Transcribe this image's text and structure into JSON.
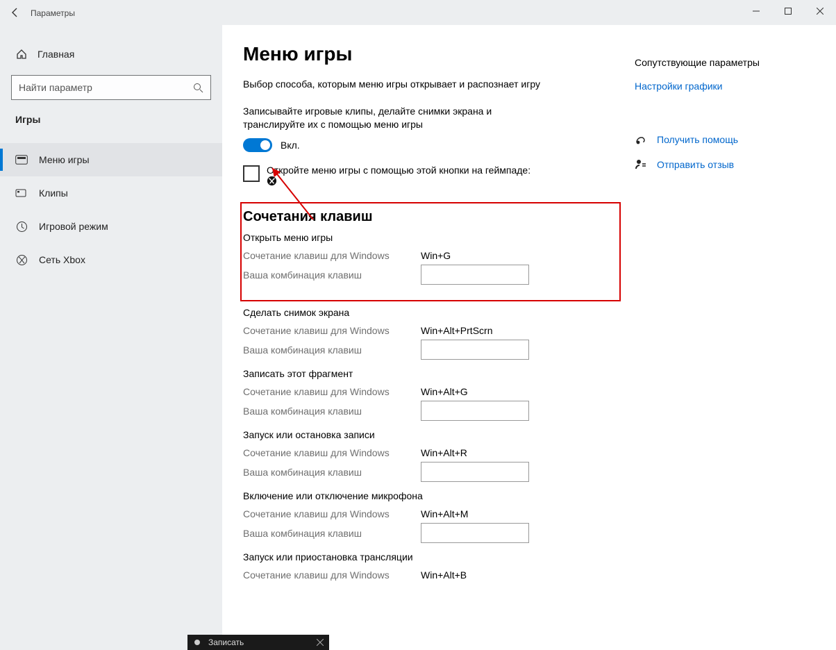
{
  "window": {
    "title": "Параметры"
  },
  "sidebar": {
    "home": "Главная",
    "search_placeholder": "Найти параметр",
    "category": "Игры",
    "items": [
      {
        "label": "Меню игры"
      },
      {
        "label": "Клипы"
      },
      {
        "label": "Игровой режим"
      },
      {
        "label": "Сеть Xbox"
      }
    ]
  },
  "page": {
    "heading": "Меню игры",
    "intro": "Выбор способа, которым меню игры открывает и распознает игру",
    "record_desc": "Записывайте игровые клипы, делайте снимки экрана и транслируйте их с помощью меню игры",
    "toggle_label": "Вкл.",
    "gamepad_checkbox": "Откройте меню игры с помощью этой кнопки на геймпаде:",
    "shortcuts_heading": "Сочетания клавиш",
    "labels": {
      "win_combo": "Сочетание клавиш для Windows",
      "custom_combo": "Ваша комбинация клавиш"
    },
    "shortcuts": [
      {
        "title": "Открыть меню игры",
        "win": "Win+G",
        "highlight": true
      },
      {
        "title": "Сделать снимок экрана",
        "win": "Win+Alt+PrtScrn"
      },
      {
        "title": "Записать этот фрагмент",
        "win": "Win+Alt+G"
      },
      {
        "title": "Запуск или остановка записи",
        "win": "Win+Alt+R"
      },
      {
        "title": "Включение или отключение микрофона",
        "win": "Win+Alt+M"
      },
      {
        "title": "Запуск или приостановка трансляции",
        "win": "Win+Alt+B"
      }
    ]
  },
  "aside": {
    "related_heading": "Сопутствующие параметры",
    "graphics_link": "Настройки графики",
    "help_link": "Получить помощь",
    "feedback_link": "Отправить отзыв"
  },
  "sysbar": {
    "record": "Записать"
  }
}
